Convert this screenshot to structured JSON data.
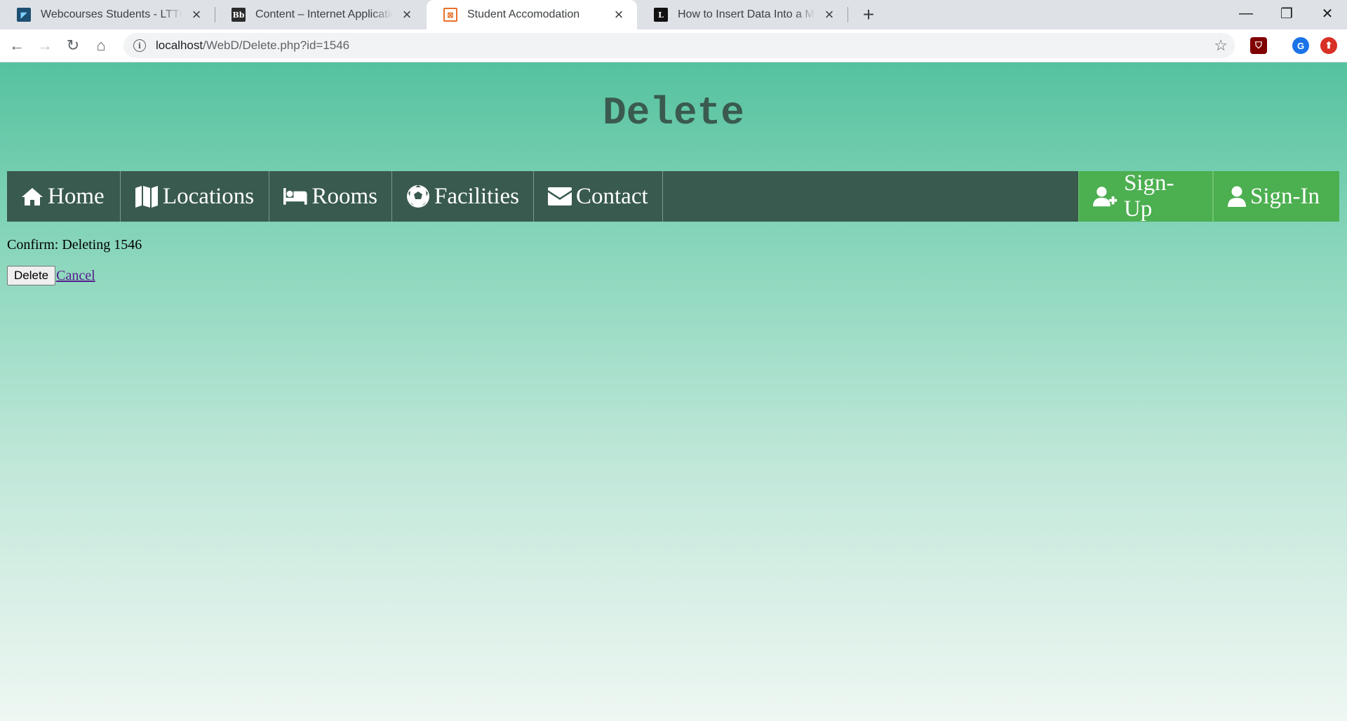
{
  "browser": {
    "tabs": [
      {
        "title": "Webcourses Students - LTTC",
        "favicon": "webcourses-icon",
        "active": false
      },
      {
        "title": "Content – Internet Application and",
        "favicon": "blackboard-icon",
        "active": false
      },
      {
        "title": "Student Accomodation",
        "favicon": "xampp-icon",
        "active": true
      },
      {
        "title": "How to Insert Data Into a MySQL",
        "favicon": "lifewire-icon",
        "active": false
      }
    ],
    "url_host": "localhost",
    "url_path": "/WebD/Delete.php?id=1546",
    "profile_initial": "G"
  },
  "page": {
    "title": "Delete",
    "nav": {
      "left": [
        {
          "label": "Home",
          "icon": "home-icon"
        },
        {
          "label": "Locations",
          "icon": "map-icon"
        },
        {
          "label": "Rooms",
          "icon": "bed-icon"
        },
        {
          "label": "Facilities",
          "icon": "soccer-ball-icon"
        },
        {
          "label": "Contact",
          "icon": "envelope-icon"
        }
      ],
      "right": [
        {
          "label": "Sign-Up",
          "icon": "user-plus-icon"
        },
        {
          "label": "Sign-In",
          "icon": "user-icon"
        }
      ]
    },
    "confirm_text": "Confirm: Deleting 1546",
    "delete_button": "Delete",
    "cancel_link": "Cancel"
  },
  "colors": {
    "nav_bg": "#395a4f",
    "auth_bg": "#4caf50",
    "title_color": "#3a5a4f"
  }
}
